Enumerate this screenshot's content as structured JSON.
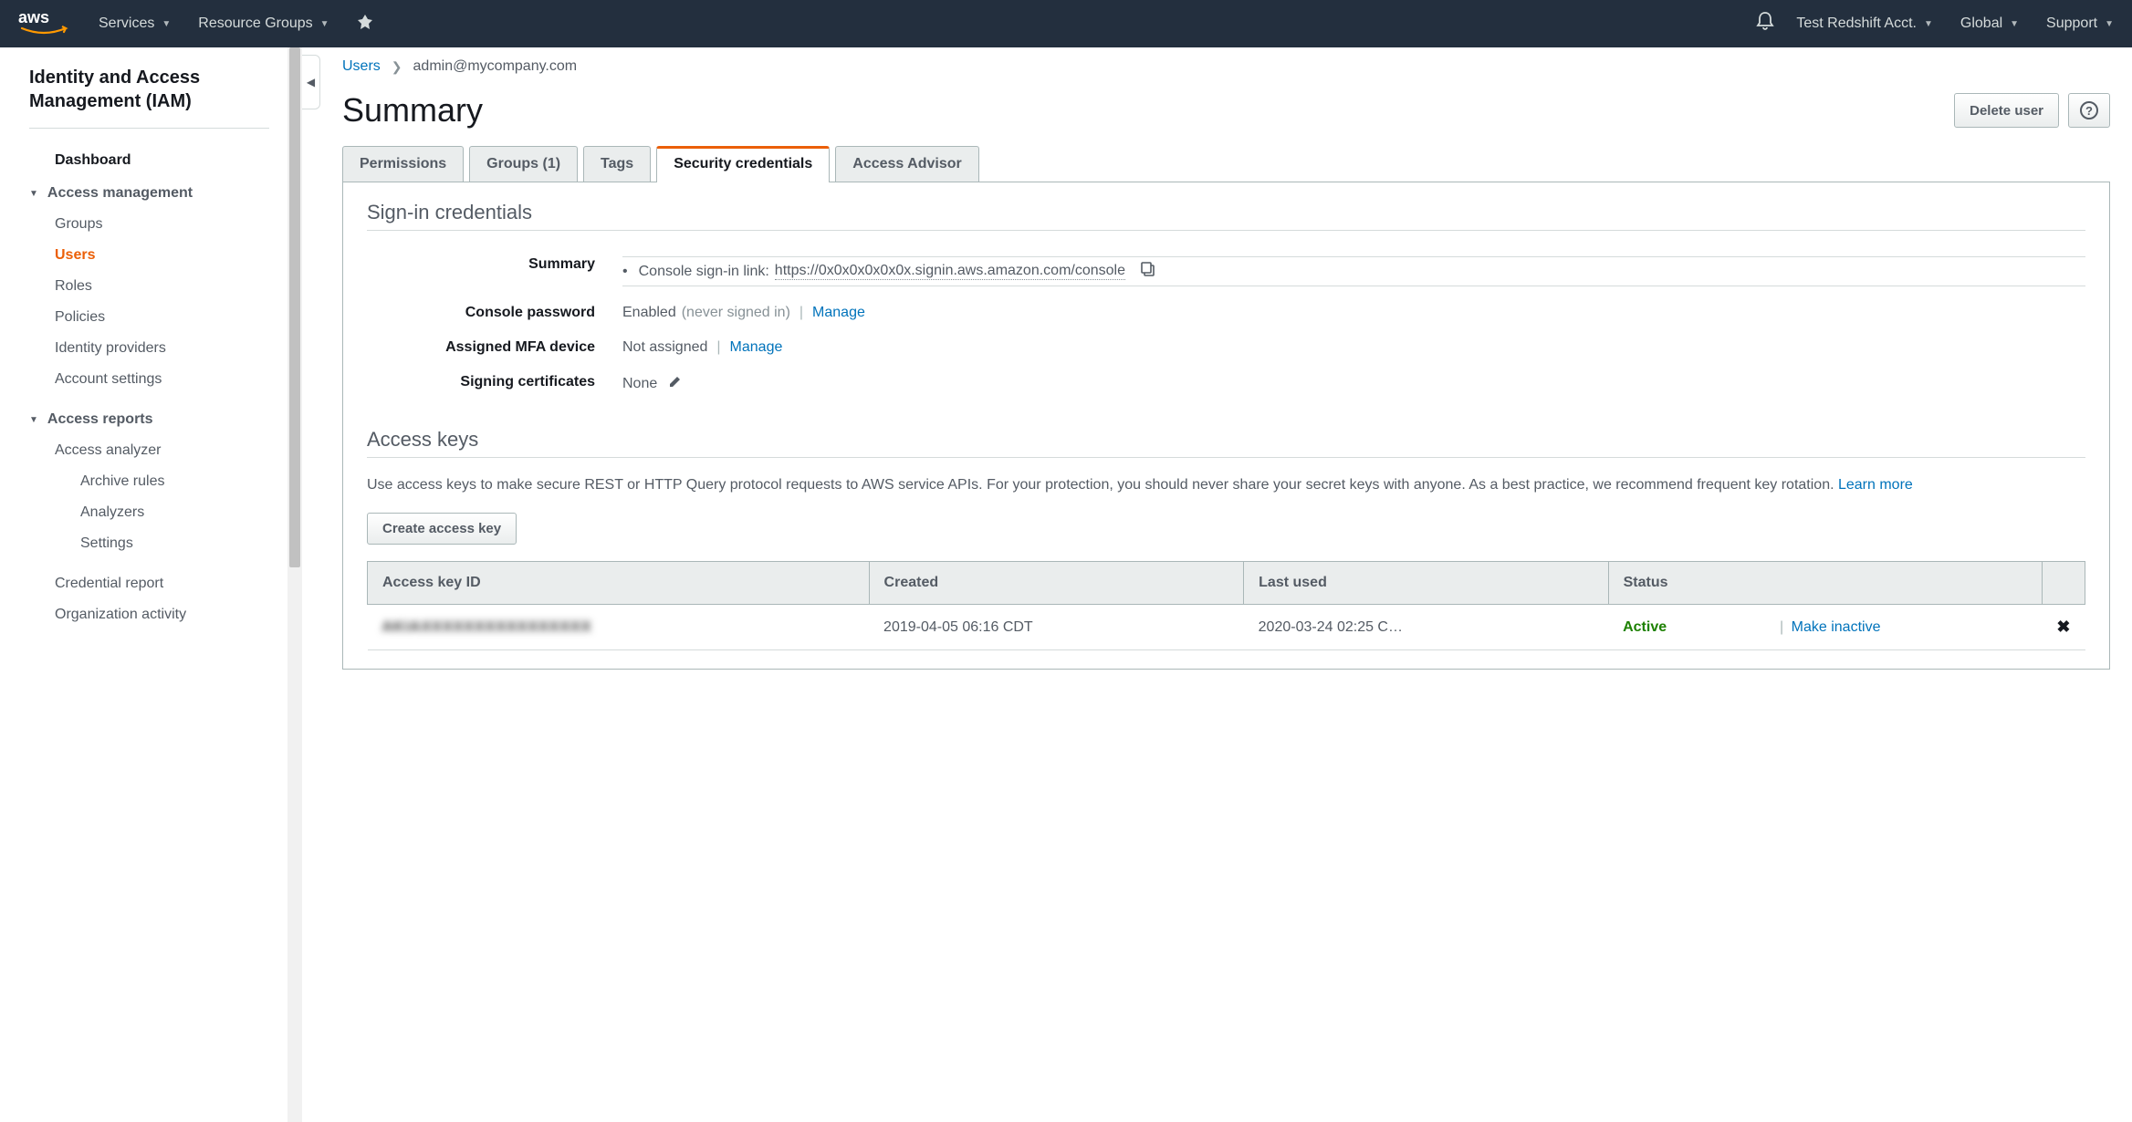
{
  "topnav": {
    "services": "Services",
    "resource_groups": "Resource Groups",
    "account": "Test Redshift Acct.",
    "region": "Global",
    "support": "Support"
  },
  "sidebar": {
    "title": "Identity and Access Management (IAM)",
    "dashboard": "Dashboard",
    "group_access_mgmt": "Access management",
    "items": {
      "groups": "Groups",
      "users": "Users",
      "roles": "Roles",
      "policies": "Policies",
      "identity_providers": "Identity providers",
      "account_settings": "Account settings"
    },
    "group_access_reports": "Access reports",
    "reports": {
      "access_analyzer": "Access analyzer",
      "archive_rules": "Archive rules",
      "analyzers": "Analyzers",
      "settings": "Settings",
      "credential_report": "Credential report",
      "organization_activity": "Organization activity"
    }
  },
  "breadcrumb": {
    "users": "Users",
    "current": "admin@mycompany.com"
  },
  "page": {
    "title": "Summary",
    "delete_user": "Delete user"
  },
  "tabs": {
    "permissions": "Permissions",
    "groups": "Groups (1)",
    "tags": "Tags",
    "security_credentials": "Security credentials",
    "access_advisor": "Access Advisor"
  },
  "signin": {
    "section_title": "Sign-in credentials",
    "summary_label": "Summary",
    "summary_text": "Console sign-in link:",
    "summary_link": "https://0x0x0x0x0x0x.signin.aws.amazon.com/console",
    "password_label": "Console password",
    "password_value": "Enabled",
    "password_note": "(never signed in)",
    "manage": "Manage",
    "mfa_label": "Assigned MFA device",
    "mfa_value": "Not assigned",
    "cert_label": "Signing certificates",
    "cert_value": "None"
  },
  "access_keys": {
    "section_title": "Access keys",
    "description": "Use access keys to make secure REST or HTTP Query protocol requests to AWS service APIs. For your protection, you should never share your secret keys with anyone. As a best practice, we recommend frequent key rotation. ",
    "learn_more": "Learn more",
    "create_btn": "Create access key",
    "columns": {
      "id": "Access key ID",
      "created": "Created",
      "last_used": "Last used",
      "status": "Status"
    },
    "rows": [
      {
        "id": "AKIAXXXXXXXXXXXXXXXX",
        "created": "2019-04-05 06:16 CDT",
        "last_used": "2020-03-24 02:25 C…",
        "status": "Active",
        "action": "Make inactive"
      }
    ]
  }
}
